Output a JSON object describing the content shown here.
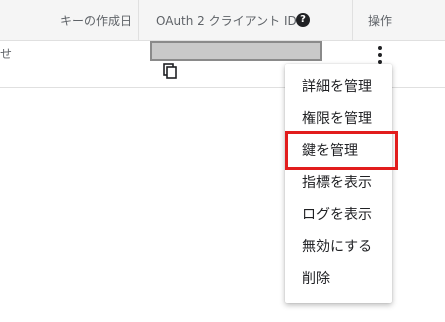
{
  "table": {
    "headers": {
      "key_created": "キーの作成日",
      "client_id": "OAuth 2 クライアント ID",
      "actions": "操作"
    },
    "row": {
      "truncated_text": "せ"
    }
  },
  "menu": {
    "items": [
      {
        "label": "詳細を管理"
      },
      {
        "label": "権限を管理"
      },
      {
        "label": "鍵を管理"
      },
      {
        "label": "指標を表示"
      },
      {
        "label": "ログを表示"
      },
      {
        "label": "無効にする"
      },
      {
        "label": "削除"
      }
    ],
    "highlighted_label": "鍵を管理"
  },
  "colors": {
    "highlight_border": "#e21d1d",
    "header_background": "#f5f5f5",
    "redaction": "#c9c9c9"
  },
  "icons": {
    "help": "help-icon",
    "copy": "copy-icon",
    "more": "more-vert-icon"
  }
}
